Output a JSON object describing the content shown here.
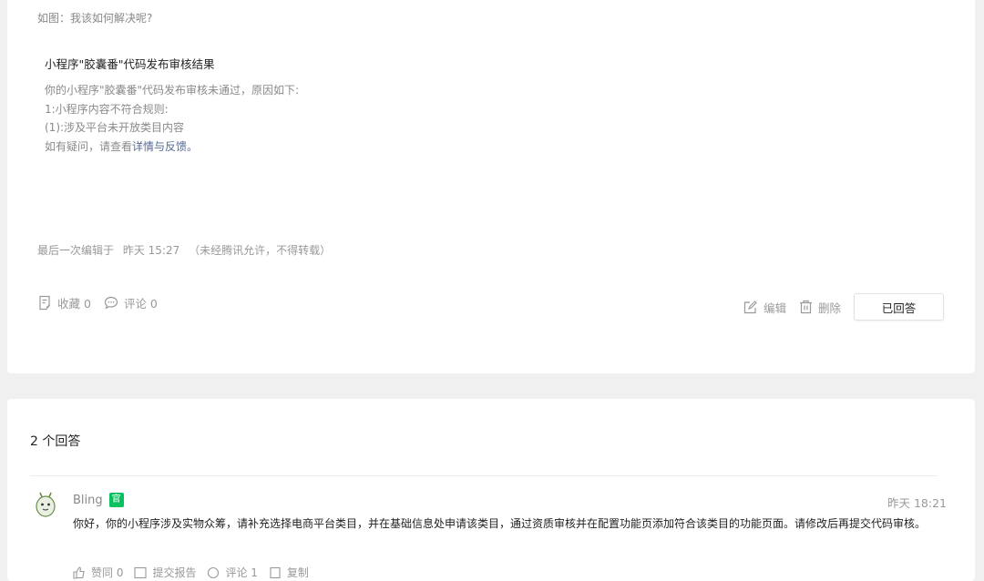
{
  "question": {
    "intro": "如图：我该如何解决呢?",
    "notice_title": "小程序\"胶囊番\"代码发布审核结果",
    "notice_lines": [
      "你的小程序\"胶囊番\"代码发布审核未通过，原因如下:",
      "1:小程序内容不符合规则:",
      "(1):涉及平台未开放类目内容"
    ],
    "notice_last_prefix": "如有疑问，请查看",
    "notice_link": "详情与反馈",
    "notice_last_suffix": "。",
    "edited_label": "最后一次编辑于",
    "edited_time": "昨天 15:27",
    "edited_note": "（未经腾讯允许，不得转载）",
    "collect_label": "收藏 0",
    "comment_label": "评论 0",
    "edit_label": "编辑",
    "delete_label": "删除",
    "answered_button": "已回答"
  },
  "answers": {
    "title": "2 个回答",
    "items": [
      {
        "user": "Bling",
        "badge": "官",
        "time": "昨天 18:21",
        "text": "你好，你的小程序涉及实物众筹，请补充选择电商平台类目，并在基础信息处申请该类目，通过资质审核并在配置功能页添加符合该类目的功能页面。请修改后再提交代码审核。",
        "actions": [
          "赞同 0",
          "提交报告",
          "评论 1",
          "复制"
        ]
      }
    ]
  },
  "colors": {
    "link": "#576b95",
    "badge": "#07c160",
    "background": "#f0f0f0"
  },
  "icons": [
    "collect-icon",
    "comment-icon",
    "edit-icon",
    "delete-icon",
    "avatar-image",
    "like-icon"
  ]
}
